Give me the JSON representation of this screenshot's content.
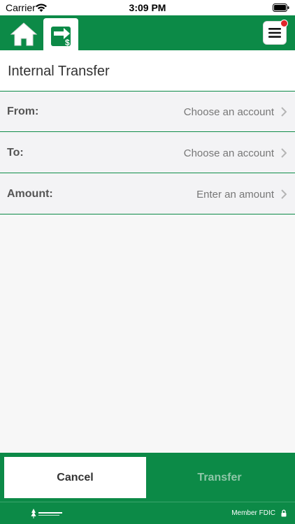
{
  "status_bar": {
    "carrier": "Carrier",
    "time": "3:09 PM"
  },
  "nav": {
    "home_icon": "home-icon",
    "transfer_icon": "transfer-dollar-icon",
    "menu_icon": "hamburger-menu-icon",
    "notification": true
  },
  "page": {
    "title": "Internal Transfer"
  },
  "form": {
    "rows": [
      {
        "label": "From:",
        "value": "Choose an account"
      },
      {
        "label": "To:",
        "value": "Choose an account"
      },
      {
        "label": "Amount:",
        "value": "Enter an amount"
      }
    ]
  },
  "actions": {
    "cancel_label": "Cancel",
    "transfer_label": "Transfer"
  },
  "footer": {
    "fdic": "Member FDIC"
  },
  "colors": {
    "brand_green": "#0c8a47",
    "notification_red": "#e0252b",
    "disabled_text": "#8fc7a8"
  }
}
